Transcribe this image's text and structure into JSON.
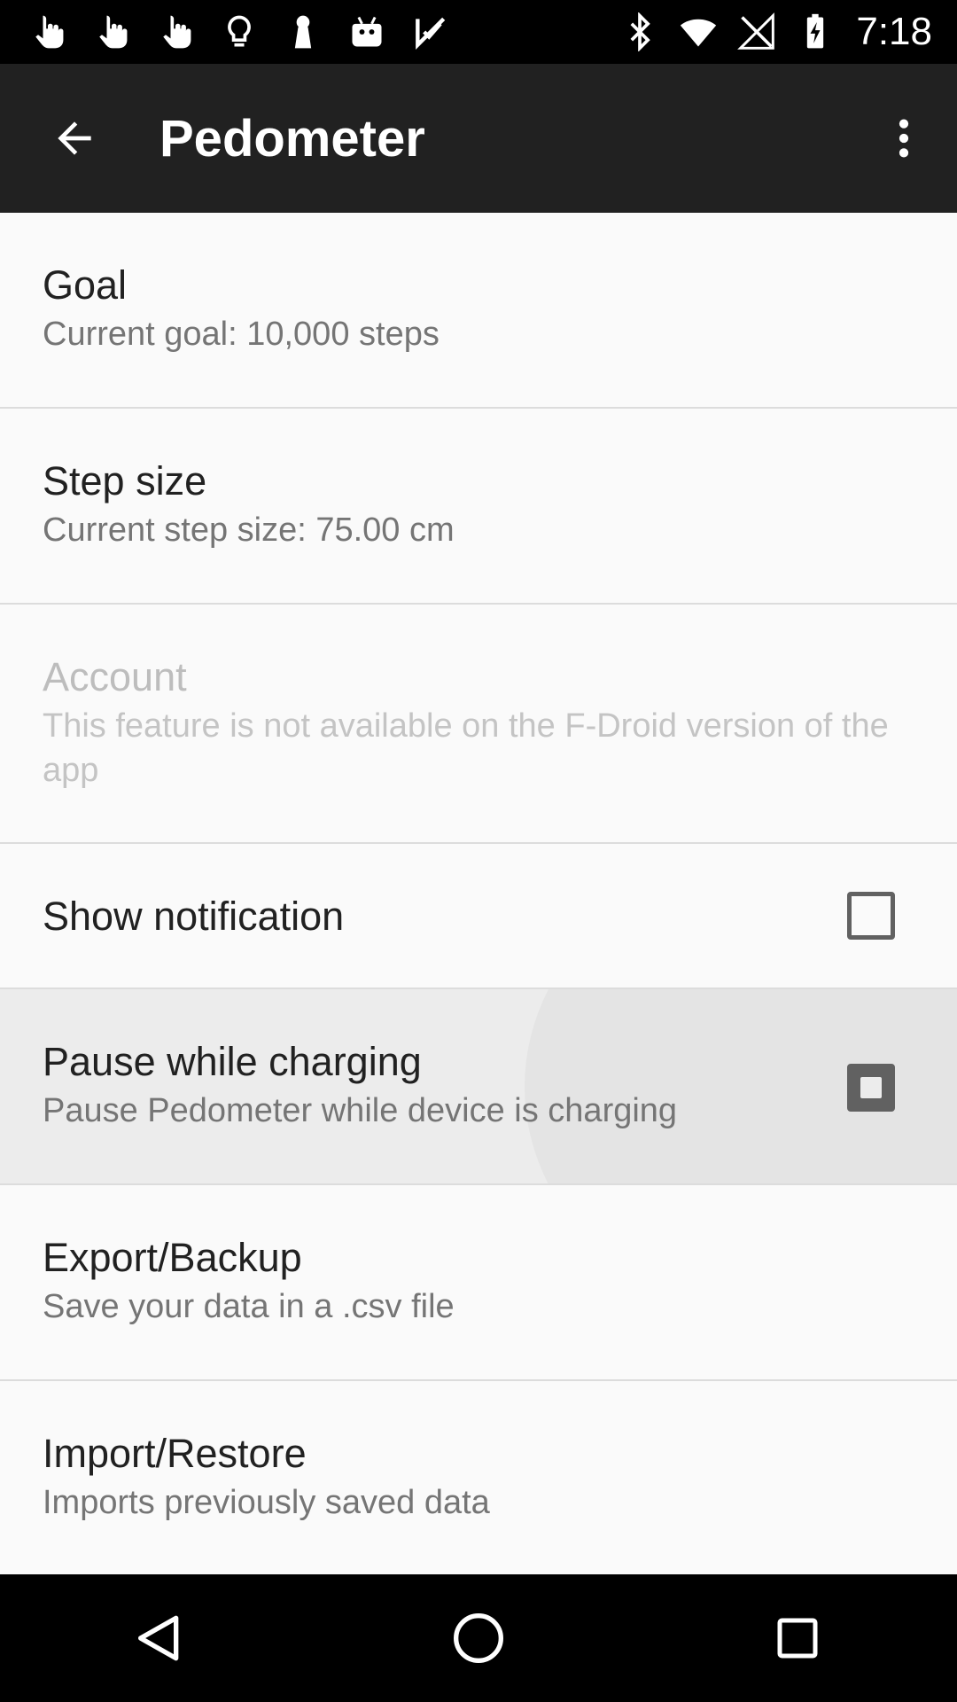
{
  "status_bar": {
    "time": "7:18",
    "left_icons": [
      "hand-touch-icon",
      "hand-touch-icon",
      "hand-touch-icon",
      "lightbulb-icon",
      "keyhole-icon",
      "android-robot-icon",
      "check-flag-icon"
    ],
    "right_icons": [
      "bluetooth-icon",
      "wifi-icon",
      "no-signal-icon",
      "battery-charging-icon"
    ]
  },
  "app_bar": {
    "title": "Pedometer",
    "back_icon": "arrow-back-icon",
    "menu_icon": "more-vertical-icon",
    "background": "#212121"
  },
  "preferences": [
    {
      "title": "Goal",
      "summary": "Current goal: 10,000 steps",
      "enabled": true
    },
    {
      "title": "Step size",
      "summary": "Current step size: 75.00 cm",
      "enabled": true
    },
    {
      "title": "Account",
      "summary": "This feature is not available on the F-Droid version of the app",
      "enabled": false
    },
    {
      "title": "Show notification",
      "summary": "",
      "enabled": true,
      "checkbox": false
    },
    {
      "title": "Pause while charging",
      "summary": "Pause Pedometer while device is charging",
      "enabled": true,
      "checkbox": "pressed"
    },
    {
      "title": "Export/Backup",
      "summary": "Save your data in a .csv file",
      "enabled": true
    },
    {
      "title": "Import/Restore",
      "summary": "Imports previously saved data",
      "enabled": true
    }
  ],
  "nav_bar": {
    "buttons": [
      "back-triangle-icon",
      "home-circle-icon",
      "recents-square-icon"
    ]
  }
}
